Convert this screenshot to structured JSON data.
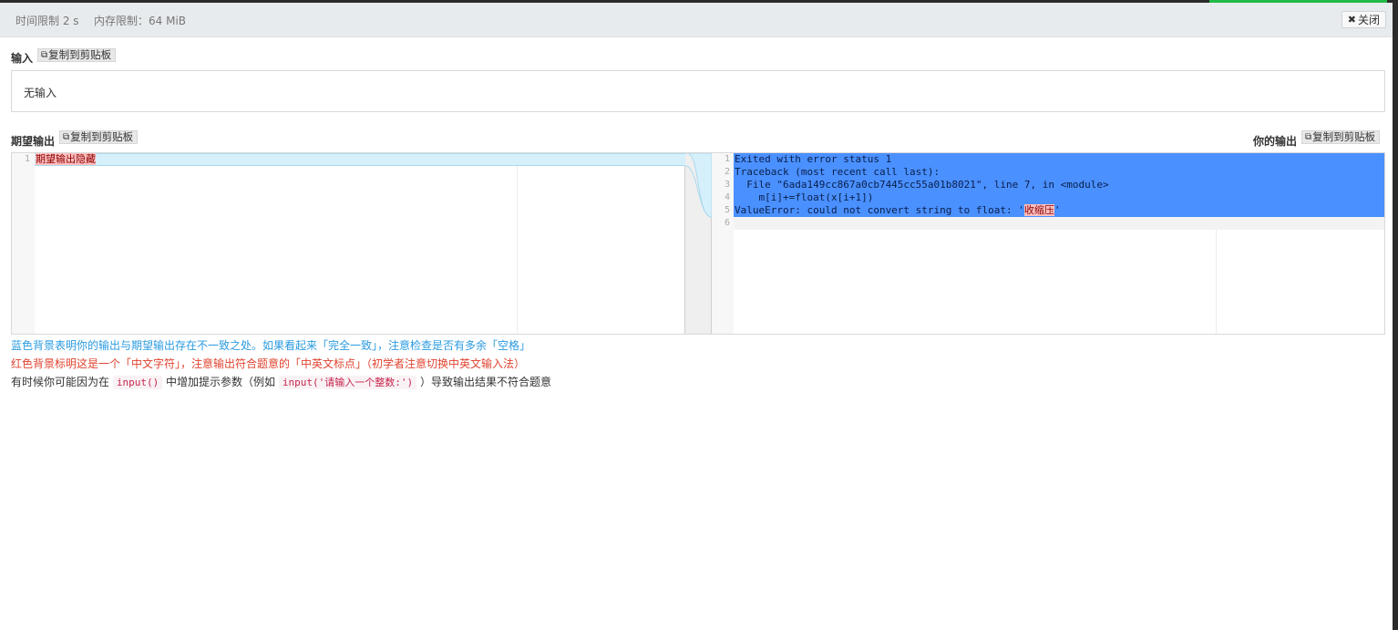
{
  "header": {
    "time_limit": "时间限制 2 s",
    "memory_limit": "内存限制：64 MiB",
    "close_label": "关闭",
    "close_icon": "close-x-icon"
  },
  "input_section": {
    "label": "输入",
    "copy_label": "复制到剪贴板",
    "value": "无输入"
  },
  "expected_section": {
    "label": "期望输出",
    "copy_label": "复制到剪贴板",
    "lines": [
      {
        "num": "1",
        "text": "期望输出隐藏"
      }
    ]
  },
  "yours_section": {
    "label": "你的输出",
    "copy_label": "复制到剪贴板",
    "lines": [
      {
        "num": "1",
        "text": "Exited with error status 1"
      },
      {
        "num": "2",
        "text": "Traceback (most recent call last):"
      },
      {
        "num": "3",
        "text": "  File \"6ada149cc867a0cb7445cc55a01b8021\", line 7, in <module>"
      },
      {
        "num": "4",
        "text": "    m[i]+=float(x[i+1])"
      },
      {
        "num": "5",
        "pre": "ValueError: could not convert string to float: '",
        "mark": "收缩压",
        "post": "'"
      },
      {
        "num": "6",
        "text": ""
      }
    ]
  },
  "notes": {
    "blue": "蓝色背景表明你的输出与期望输出存在不一致之处。如果看起来「完全一致」，注意检查是否有多余「空格」",
    "red": "红色背景标明这是一个「中文字符」，注意输出符合题意的「中英文标点」（初学者注意切换中英文输入法）",
    "gray_pre": "有时候你可能因为在",
    "gray_code1": "input()",
    "gray_mid": "中增加提示参数（例如",
    "gray_code2": "input('请输入一个整数:')",
    "gray_post": "）导致输出结果不符合题意"
  },
  "colors": {
    "progress": "#21ba45",
    "diff_blue": "#4a90ff",
    "diff_light": "#d6f0fb",
    "chinese_red": "#ffc0c0",
    "note_blue": "#2b9be0",
    "note_red": "#e0432f"
  }
}
